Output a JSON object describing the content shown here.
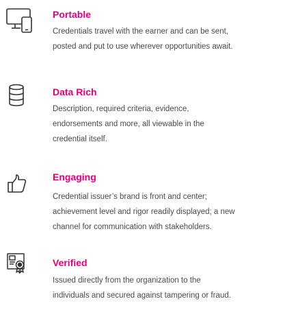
{
  "theme": {
    "accent_color": "#e2007a",
    "text_color": "#4a4a4a",
    "icon_color": "#333333"
  },
  "features": [
    {
      "icon": "devices-icon",
      "title": "Portable",
      "lines": [
        "Credentials travel with the earner and can be sent,",
        "posted and put to use wherever opportunities await."
      ]
    },
    {
      "icon": "database-icon",
      "title": "Data Rich",
      "lines": [
        "Description, required criteria, evidence,",
        "endorsements and more, all viewable in the",
        "credential itself."
      ]
    },
    {
      "icon": "thumbs-up-icon",
      "title": "Engaging",
      "lines": [
        "Credential issuer’s brand is front and center;",
        "achievement level and rigor readily displayed; a new",
        "channel for communication with stakeholders."
      ]
    },
    {
      "icon": "certificate-badge-icon",
      "title": "Verified",
      "lines": [
        "Issued directly from the organization to the",
        "individuals and secured against tampering or fraud."
      ]
    }
  ]
}
